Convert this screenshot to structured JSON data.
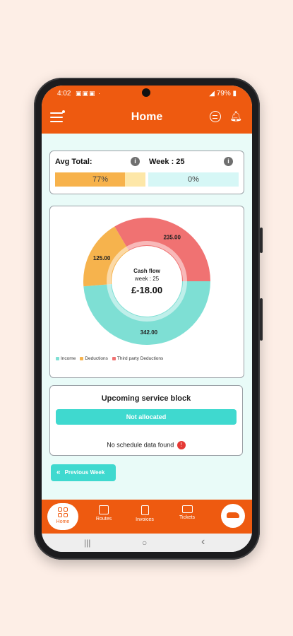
{
  "status": {
    "time": "4:02",
    "icons": "▣▣▣ ·",
    "right": "◢ 79% ▮"
  },
  "header": {
    "title": "Home"
  },
  "summary": {
    "avg_label": "Avg Total:",
    "avg_value": "77%",
    "avg_fraction": 0.77,
    "week_label": "Week : 25",
    "week_value": "0%",
    "info_glyph": "i"
  },
  "chart_data": {
    "type": "pie",
    "donut": true,
    "categories": [
      "Income",
      "Deductions",
      "Third party Deductions"
    ],
    "values": [
      342.0,
      125.0,
      235.0
    ],
    "data_labels": [
      "342.00",
      "125.00",
      "235.00"
    ],
    "colors": [
      "#7edfd4",
      "#f6b34d",
      "#f07272"
    ],
    "center_title": "Cash flow",
    "center_subtitle": "week : 25",
    "center_value": "£-18.00",
    "legend_position": "bottom-left"
  },
  "service": {
    "title": "Upcoming service block",
    "button": "Not allocated",
    "empty_text": "No schedule data found",
    "badge": "!"
  },
  "prev_week": {
    "label": "Previous Week",
    "icon": "chevrons-left-icon"
  },
  "nav": {
    "home": "Home",
    "routes": "Routes",
    "invoices": "Invoices",
    "tickets": "Tickets"
  },
  "sys": {
    "recent": "|||",
    "home": "○",
    "back": "‹"
  },
  "colors": {
    "primary": "#ee5a10",
    "teal": "#3fd9cf",
    "page_bg": "#fdeee6",
    "screen_bg": "#e9fbf8"
  }
}
